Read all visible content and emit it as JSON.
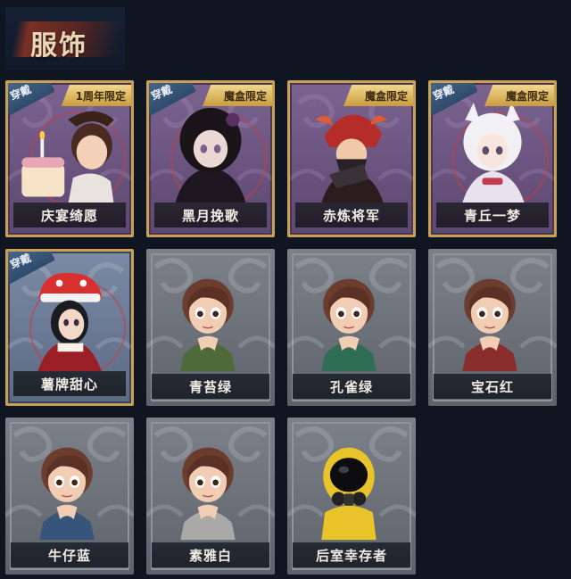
{
  "header": {
    "title": "服饰"
  },
  "badges": {
    "equipped": "穿戴"
  },
  "costumes": [
    {
      "name": "庆宴绮愿",
      "tier": "purple",
      "equipped": true,
      "limited": "1周年限定",
      "style": "cake"
    },
    {
      "name": "黑月挽歌",
      "tier": "purple",
      "equipped": true,
      "limited": "魔盒限定",
      "style": "darkgirl"
    },
    {
      "name": "赤炼将军",
      "tier": "purple",
      "equipped": false,
      "limited": "魔盒限定",
      "style": "general"
    },
    {
      "name": "青丘一梦",
      "tier": "purple",
      "equipped": true,
      "limited": "魔盒限定",
      "style": "whitefox"
    },
    {
      "name": "薯牌甜心",
      "tier": "blue",
      "equipped": true,
      "limited": "",
      "style": "chipsgirl"
    },
    {
      "name": "青苔绿",
      "tier": "gray",
      "equipped": false,
      "limited": "",
      "style": "girl",
      "coat": "#4f6a3a"
    },
    {
      "name": "孔雀绿",
      "tier": "gray",
      "equipped": false,
      "limited": "",
      "style": "girl",
      "coat": "#2f6d55"
    },
    {
      "name": "宝石红",
      "tier": "gray",
      "equipped": false,
      "limited": "",
      "style": "girl",
      "coat": "#8a2d2d"
    },
    {
      "name": "牛仔蓝",
      "tier": "gray",
      "equipped": false,
      "limited": "",
      "style": "girl",
      "coat": "#37557a"
    },
    {
      "name": "素雅白",
      "tier": "gray",
      "equipped": false,
      "limited": "",
      "style": "girl",
      "coat": "#a9aaa8"
    },
    {
      "name": "后室幸存者",
      "tier": "gray",
      "equipped": false,
      "limited": "",
      "style": "hazmat"
    }
  ]
}
